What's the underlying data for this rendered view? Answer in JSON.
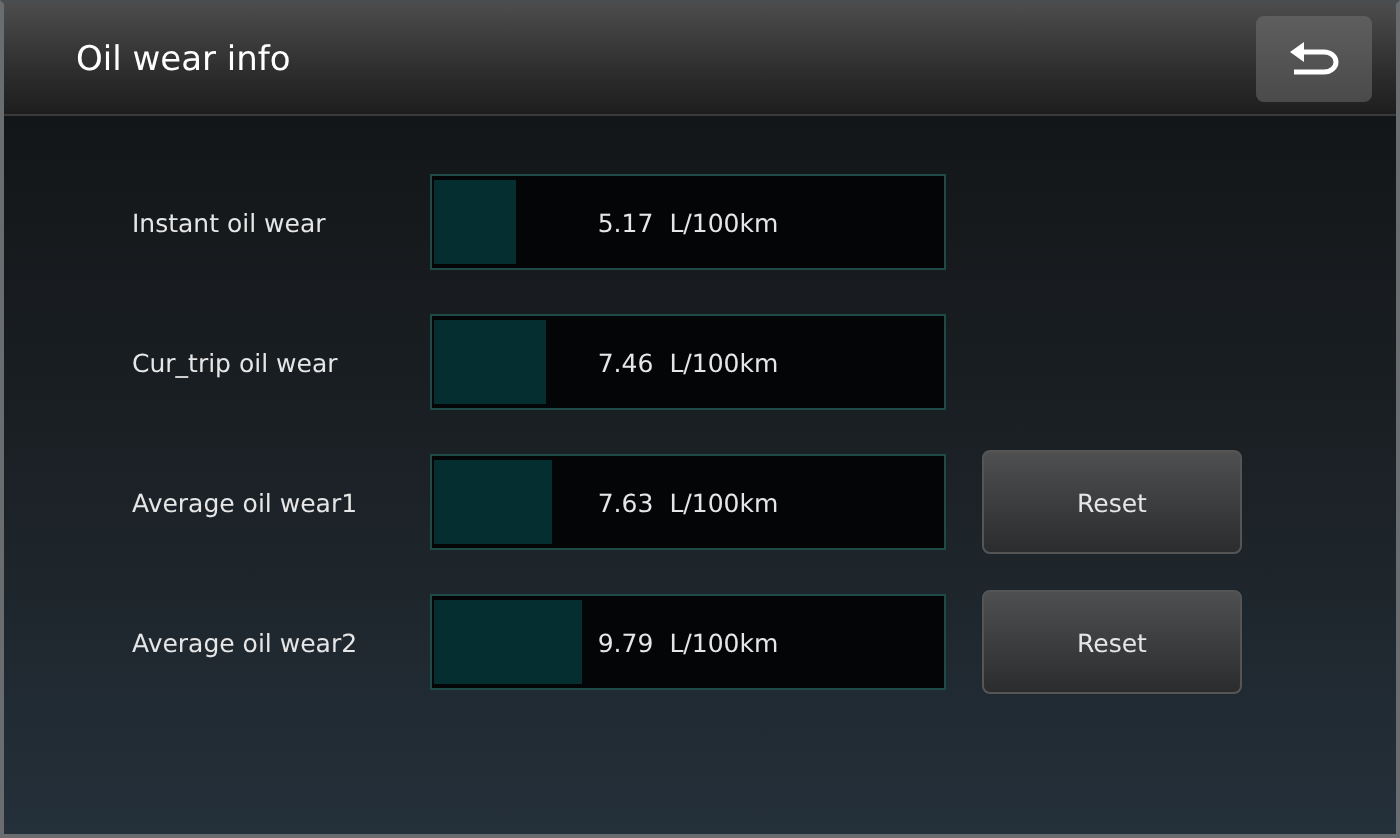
{
  "window": {
    "title": "Oil wear info"
  },
  "rows": [
    {
      "label": "Instant oil wear",
      "level": 0.16,
      "reading": "5.17",
      "unit": "L/100km"
    },
    {
      "label": "Cur_trip oil wear",
      "level": 0.22,
      "reading": "7.46",
      "unit": "L/100km"
    },
    {
      "label": "Average oil wear1",
      "level": 0.23,
      "reading": "7.63",
      "unit": "L/100km",
      "button": "Reset"
    },
    {
      "label": "Average oil wear2",
      "level": 0.29,
      "reading": "9.79",
      "unit": "L/100km",
      "button": "Reset"
    }
  ]
}
